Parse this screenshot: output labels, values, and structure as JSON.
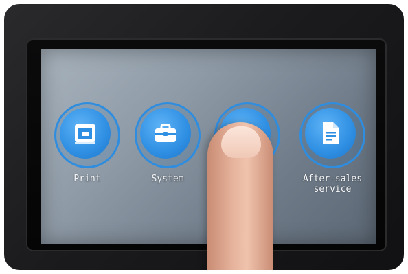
{
  "menu": {
    "items": [
      {
        "label": "Print",
        "icon": "printer-icon"
      },
      {
        "label": "System",
        "icon": "toolbox-icon"
      },
      {
        "label": "",
        "icon": "tools-icon"
      },
      {
        "label": "After-sales\nservice",
        "icon": "document-icon"
      }
    ]
  },
  "colors": {
    "accent": "#2f8de0",
    "label": "#f4f6f8"
  }
}
